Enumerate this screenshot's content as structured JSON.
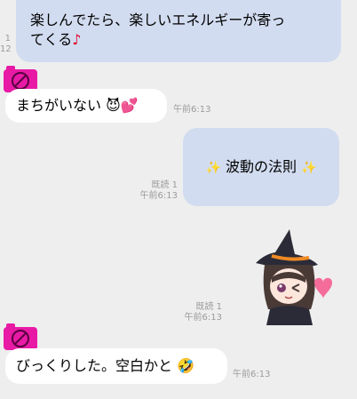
{
  "messages": [
    {
      "text_line1": "楽しんでたら、楽しいエネルギーが寄っ",
      "text_line2": "てくる",
      "emoji": "♪",
      "meta_partial_1": "1",
      "meta_partial_2": "12"
    },
    {
      "text": "まちがいない",
      "emoji": "😈💕",
      "time": "午前6:13"
    },
    {
      "text": "波動の法則",
      "sparkle_left": "✨",
      "sparkle_right": "✨",
      "read": "既読 1",
      "time": "午前6:13"
    },
    {
      "read": "既読 1",
      "time": "午前6:13"
    },
    {
      "text": "びっくりした。空白かと",
      "emoji": "🤣",
      "time": "午前6:13"
    }
  ],
  "colors": {
    "background": "#eeeeee",
    "incoming_bubble": "#ffffff",
    "outgoing_bubble": "#d2dcf0",
    "avatar": "#e81aa5",
    "meta_text": "#9b9b9b"
  },
  "icons": {
    "avatar": "camera-avatar-icon",
    "sticker": "witch-girl-sticker"
  }
}
